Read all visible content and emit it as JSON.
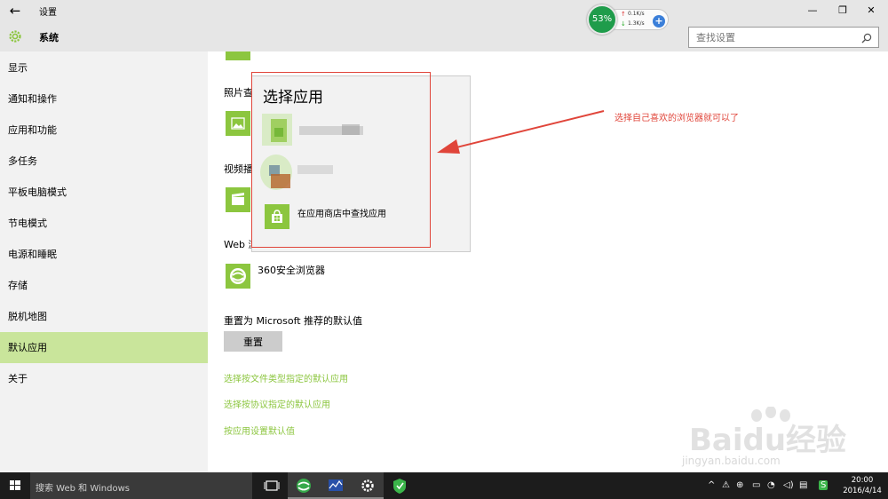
{
  "window": {
    "title": "设置",
    "back_icon": "arrow-left-icon",
    "minimize": "—",
    "maximize": "❐",
    "close": "✕"
  },
  "header": {
    "section_title": "系统",
    "search_placeholder": "查找设置"
  },
  "net_widget": {
    "percent": "53%",
    "upload": "0.1K/s",
    "download": "1.3K/s",
    "plus": "+"
  },
  "sidebar": {
    "items": [
      {
        "label": "显示"
      },
      {
        "label": "通知和操作"
      },
      {
        "label": "应用和功能"
      },
      {
        "label": "多任务"
      },
      {
        "label": "平板电脑模式"
      },
      {
        "label": "节电模式"
      },
      {
        "label": "电源和睡眠"
      },
      {
        "label": "存储"
      },
      {
        "label": "脱机地图"
      },
      {
        "label": "默认应用",
        "selected": true
      },
      {
        "label": "关于"
      }
    ]
  },
  "main": {
    "photo_label": "照片查",
    "video_label": "视频播",
    "web_label": "Web 浏",
    "browser_name": "360安全浏览器",
    "reset_label": "重置为 Microsoft 推荐的默认值",
    "reset_button": "重置",
    "links": [
      "选择按文件类型指定的默认应用",
      "选择按协议指定的默认应用",
      "按应用设置默认值"
    ]
  },
  "flyout": {
    "title": "选择应用",
    "store_label": "在应用商店中查找应用"
  },
  "annotation": {
    "text": "选择自己喜欢的浏览器就可以了",
    "color": "#e0453a"
  },
  "taskbar": {
    "search_text": "搜索 Web 和 Windows",
    "time": "20:00",
    "date": "2016/4/14"
  },
  "watermark": {
    "text": "Baidu经验",
    "sub": "jingyan.baidu.com"
  },
  "colors": {
    "accent": "#8cc63f",
    "selected_nav": "#c9e59b"
  }
}
